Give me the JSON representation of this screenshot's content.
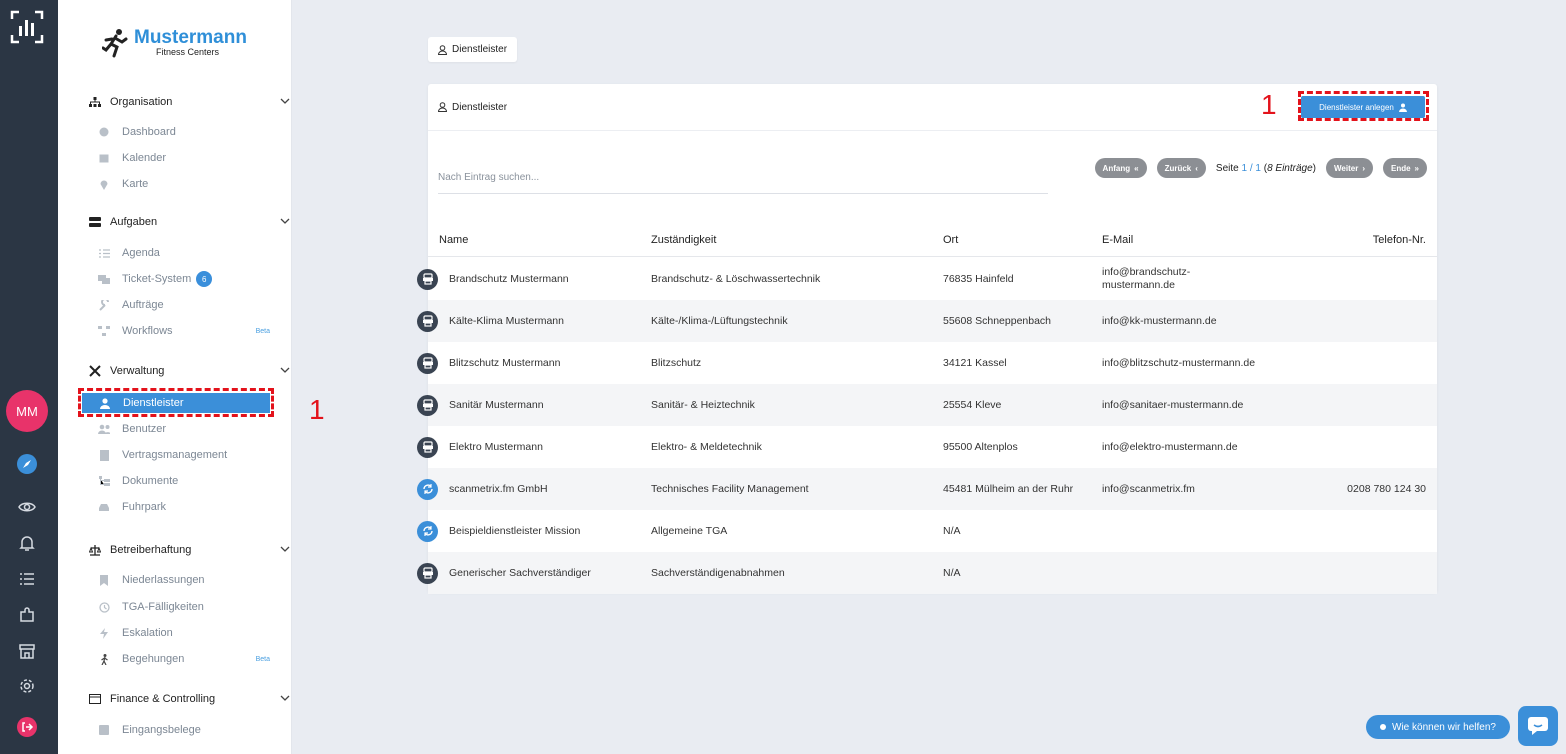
{
  "brand": {
    "name": "Mustermann",
    "subtitle": "Fitness Centers"
  },
  "rail": {
    "avatar_initials": "MM"
  },
  "sidebar": {
    "sections": [
      {
        "title": "Organisation",
        "items": [
          {
            "label": "Dashboard"
          },
          {
            "label": "Kalender"
          },
          {
            "label": "Karte"
          }
        ]
      },
      {
        "title": "Aufgaben",
        "items": [
          {
            "label": "Agenda"
          },
          {
            "label": "Ticket-System",
            "badge": "6"
          },
          {
            "label": "Aufträge"
          },
          {
            "label": "Workflows",
            "tag": "Beta"
          }
        ]
      },
      {
        "title": "Verwaltung",
        "items": [
          {
            "label": "Dienstleister"
          },
          {
            "label": "Benutzer"
          },
          {
            "label": "Vertragsmanagement"
          },
          {
            "label": "Dokumente"
          },
          {
            "label": "Fuhrpark"
          }
        ]
      },
      {
        "title": "Betreiberhaftung",
        "items": [
          {
            "label": "Niederlassungen"
          },
          {
            "label": "TGA-Fälligkeiten"
          },
          {
            "label": "Eskalation"
          },
          {
            "label": "Begehungen",
            "tag": "Beta"
          }
        ]
      },
      {
        "title": "Finance & Controlling",
        "items": [
          {
            "label": "Eingangsbelege"
          }
        ]
      }
    ]
  },
  "annotations": {
    "marker_1": "1",
    "marker_2": "1"
  },
  "breadcrumb": {
    "label": "Dienstleister"
  },
  "card": {
    "title": "Dienstleister",
    "add_button": "Dienstleister anlegen",
    "search_placeholder": "Nach Eintrag suchen...",
    "pager": {
      "first": "Anfang",
      "prev": "Zurück",
      "next": "Weiter",
      "last": "Ende",
      "page_prefix": "Seite",
      "page_current": "1",
      "page_sep": " / ",
      "page_total": "1",
      "entries": "8 Einträge"
    },
    "columns": [
      "Name",
      "Zuständigkeit",
      "Ort",
      "E-Mail",
      "Telefon-Nr."
    ],
    "rows": [
      {
        "icon": "dark",
        "name": "Brandschutz Mustermann",
        "scope": "Brandschutz- & Löschwassertechnik",
        "place": "76835 Hainfeld",
        "email_1": "info@brandschutz-",
        "email_2": "mustermann.de",
        "phone": ""
      },
      {
        "icon": "dark",
        "name": "Kälte-Klima Mustermann",
        "scope": "Kälte-/Klima-/Lüftungstechnik",
        "place": "55608 Schneppenbach",
        "email_1": "info@kk-mustermann.de",
        "email_2": "",
        "phone": ""
      },
      {
        "icon": "dark",
        "name": "Blitzschutz Mustermann",
        "scope": "Blitzschutz",
        "place": "34121 Kassel",
        "email_1": "info@blitzschutz-mustermann.de",
        "email_2": "",
        "phone": ""
      },
      {
        "icon": "dark",
        "name": "Sanitär Mustermann",
        "scope": "Sanitär- & Heiztechnik",
        "place": "25554 Kleve",
        "email_1": "info@sanitaer-mustermann.de",
        "email_2": "",
        "phone": ""
      },
      {
        "icon": "dark",
        "name": "Elektro Mustermann",
        "scope": "Elektro- & Meldetechnik",
        "place": "95500 Altenplos",
        "email_1": "info@elektro-mustermann.de",
        "email_2": "",
        "phone": ""
      },
      {
        "icon": "blue",
        "name": "scanmetrix.fm GmbH",
        "scope": "Technisches Facility Management",
        "place": "45481 Mülheim an der Ruhr",
        "email_1": "info@scanmetrix.fm",
        "email_2": "",
        "phone": "0208 780 124 30"
      },
      {
        "icon": "blue",
        "name": "Beispieldienstleister Mission",
        "scope": "Allgemeine TGA",
        "place": "N/A",
        "email_1": "",
        "email_2": "",
        "phone": ""
      },
      {
        "icon": "dark",
        "name": "Generischer Sachverständiger",
        "scope": "Sachverständigenabnahmen",
        "place": "N/A",
        "email_1": "",
        "email_2": "",
        "phone": ""
      }
    ]
  },
  "help": {
    "label": "Wie können wir helfen?"
  },
  "colors": {
    "accent": "#3b8fd9",
    "rail": "#2b3644",
    "avatar": "#e8336a",
    "highlight": "#e3121b"
  }
}
